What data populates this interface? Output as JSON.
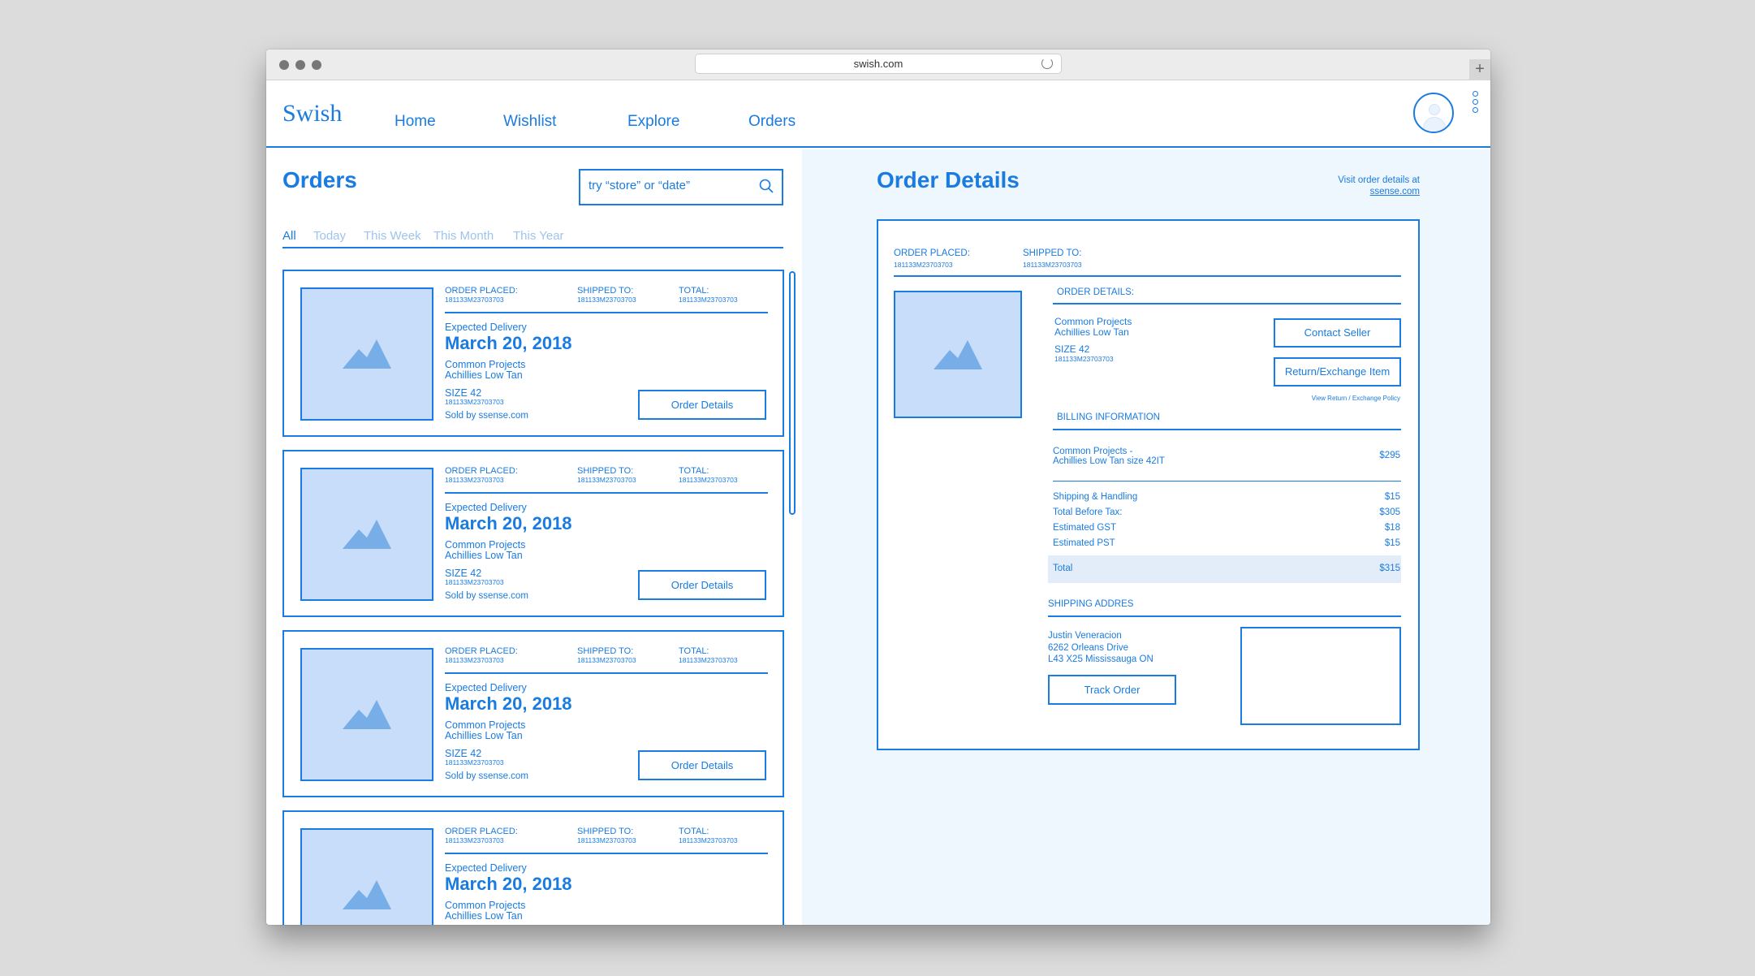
{
  "browser": {
    "url": "swish.com",
    "new_tab": "+"
  },
  "nav": {
    "logo": "Swish",
    "items": [
      "Home",
      "Wishlist",
      "Explore",
      "Orders"
    ]
  },
  "orders": {
    "title": "Orders",
    "search_placeholder": "try “store” or “date”",
    "filters": [
      "All",
      "Today",
      "This Week",
      "This Month",
      "This Year"
    ],
    "active_filter": "All",
    "cards": [
      {
        "order_placed_label": "ORDER PLACED:",
        "order_placed": "181133M23703703",
        "shipped_to_label": "SHIPPED TO:",
        "shipped_to": "181133M23703703",
        "total_label": "TOTAL:",
        "total": "181133M23703703",
        "expected_label": "Expected Delivery",
        "date": "March 20, 2018",
        "brand": "Common Projects",
        "product": "Achillies Low Tan",
        "size": "SIZE 42",
        "sku": "181133M23703703",
        "sold_by": "Sold by ssense.com",
        "button": "Order Details"
      },
      {
        "order_placed_label": "ORDER PLACED:",
        "order_placed": "181133M23703703",
        "shipped_to_label": "SHIPPED TO:",
        "shipped_to": "181133M23703703",
        "total_label": "TOTAL:",
        "total": "181133M23703703",
        "expected_label": "Expected Delivery",
        "date": "March 20, 2018",
        "brand": "Common Projects",
        "product": "Achillies Low Tan",
        "size": "SIZE 42",
        "sku": "181133M23703703",
        "sold_by": "Sold by ssense.com",
        "button": "Order Details"
      },
      {
        "order_placed_label": "ORDER PLACED:",
        "order_placed": "181133M23703703",
        "shipped_to_label": "SHIPPED TO:",
        "shipped_to": "181133M23703703",
        "total_label": "TOTAL:",
        "total": "181133M23703703",
        "expected_label": "Expected Delivery",
        "date": "March 20, 2018",
        "brand": "Common Projects",
        "product": "Achillies Low Tan",
        "size": "SIZE 42",
        "sku": "181133M23703703",
        "sold_by": "Sold by ssense.com",
        "button": "Order Details"
      },
      {
        "order_placed_label": "ORDER PLACED:",
        "order_placed": "181133M23703703",
        "shipped_to_label": "SHIPPED TO:",
        "shipped_to": "181133M23703703",
        "total_label": "TOTAL:",
        "total": "181133M23703703",
        "expected_label": "Expected Delivery",
        "date": "March 20, 2018",
        "brand": "Common Projects",
        "product": "Achillies Low Tan",
        "size": "",
        "sku": "",
        "sold_by": "",
        "button": ""
      }
    ]
  },
  "details": {
    "title": "Order Details",
    "visit_text": "Visit order details at",
    "visit_link": "ssense.com",
    "order_placed_label": "ORDER PLACED:",
    "order_placed": "181133M23703703",
    "shipped_to_label": "SHIPPED TO:",
    "shipped_to": "181133M23703703",
    "section_order": "ORDER DETAILS:",
    "brand": "Common Projects",
    "product": "Achillies Low Tan",
    "size": "SIZE 42",
    "sku": "181133M23703703",
    "contact_button": "Contact Seller",
    "return_button": "Return/Exchange Item",
    "return_policy": "View Return / Exchange Policy",
    "section_billing": "BILLING INFORMATION",
    "billing_item_line1": "Common Projects -",
    "billing_item_line2": "Achillies Low Tan size 42IT",
    "billing_item_amount": "$295",
    "lines": [
      {
        "label": "Shipping & Handling",
        "amount": "$15"
      },
      {
        "label": "Total Before Tax:",
        "amount": "$305"
      },
      {
        "label": "Estimated GST",
        "amount": "$18"
      },
      {
        "label": "Estimated PST",
        "amount": "$15"
      }
    ],
    "total_label": "Total",
    "total_amount": "$315",
    "section_shipping": "SHIPPING ADDRES",
    "address": [
      "Justin Veneracion",
      "6262 Orleans Drive",
      "L43 X25 Mississauga ON"
    ],
    "track_button": "Track Order"
  },
  "colors": {
    "accent": "#1a7be0",
    "image_fill": "#c7ddf9",
    "mountain": "#78aee8",
    "detail_bg": "#eef6fe"
  }
}
